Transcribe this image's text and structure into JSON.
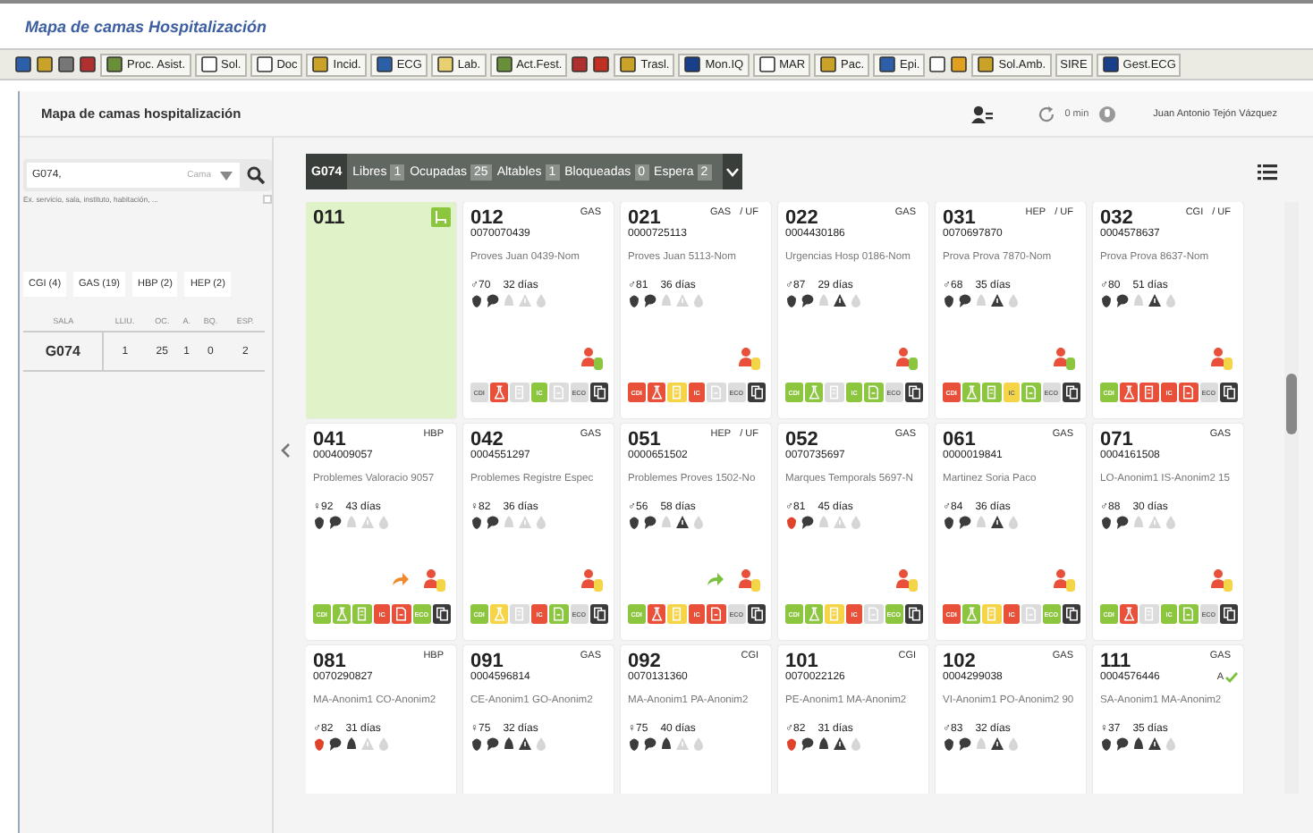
{
  "window": {
    "title": "Mapa de camas Hospitalización"
  },
  "toolbar": [
    {
      "kind": "icon",
      "color": "#2b5fa8"
    },
    {
      "kind": "icon",
      "color": "#c9a227"
    },
    {
      "kind": "icon",
      "color": "#777777"
    },
    {
      "kind": "icon",
      "color": "#b03030"
    },
    {
      "kind": "labeled",
      "color": "#6a8f3a",
      "label": "Proc. Asist."
    },
    {
      "kind": "labeled",
      "color": "#ffffff",
      "label": "Sol."
    },
    {
      "kind": "labeled",
      "color": "#ffffff",
      "label": "Doc"
    },
    {
      "kind": "labeled",
      "color": "#c9a227",
      "label": "Incid."
    },
    {
      "kind": "labeled",
      "color": "#2b5fa8",
      "label": "ECG"
    },
    {
      "kind": "labeled",
      "color": "#e8d070",
      "label": "Lab."
    },
    {
      "kind": "labeled",
      "color": "#6a8f3a",
      "label": "Act.Fest."
    },
    {
      "kind": "icon",
      "color": "#b03030"
    },
    {
      "kind": "icon",
      "color": "#c03020"
    },
    {
      "kind": "labeled",
      "color": "#c9a227",
      "label": "Trasl."
    },
    {
      "kind": "labeled",
      "color": "#1a3f8a",
      "label": "Mon.IQ"
    },
    {
      "kind": "labeled",
      "color": "#ffffff",
      "label": "MAR"
    },
    {
      "kind": "labeled",
      "color": "#c9a227",
      "label": "Pac."
    },
    {
      "kind": "labeled",
      "color": "#2b5fa8",
      "label": "Epi."
    },
    {
      "kind": "icon",
      "color": "#ffffff"
    },
    {
      "kind": "icon",
      "color": "#e0a020"
    },
    {
      "kind": "labeled",
      "color": "#c9a227",
      "label": "Sol.Amb."
    },
    {
      "kind": "text",
      "label": "SIRE"
    },
    {
      "kind": "labeled",
      "color": "#1a3f8a",
      "label": "Gest.ECG"
    }
  ],
  "header": {
    "title": "Mapa de camas hospitalización",
    "refresh": "0 min",
    "user": "Juan Antonio Tejón Vázquez"
  },
  "search": {
    "value": "G074,",
    "select_placeholder": "Cama",
    "hint": "Ex. servicio, sala, instituto, habitación, ...",
    "option_checked": false
  },
  "filters": [
    "CGI (4)",
    "GAS (19)",
    "HBP (2)",
    "HEP (2)"
  ],
  "ward_table": {
    "columns": [
      "SALA",
      "LLIU.",
      "OC.",
      "A.",
      "BQ.",
      "ESP."
    ],
    "rows": [
      [
        "G074",
        "1",
        "25",
        "1",
        "0",
        "2"
      ]
    ]
  },
  "summary": {
    "ward": "G074",
    "counts": [
      {
        "label": "Libres",
        "value": "1"
      },
      {
        "label": "Ocupadas",
        "value": "25"
      },
      {
        "label": "Altables",
        "value": "1"
      },
      {
        "label": "Bloqueadas",
        "value": "0"
      },
      {
        "label": "Espera",
        "value": "2"
      }
    ]
  },
  "beds": [
    {
      "kind": "free",
      "number": "011"
    },
    {
      "kind": "occupied",
      "number": "012",
      "service": "GAS",
      "nhc": "0070070439",
      "name": "Proves Juan 0439-Nom",
      "patient": "♂70",
      "stay": "32 días",
      "indicators": [
        {
          "kind": "pepper",
          "color": "#3c3c3c"
        },
        {
          "kind": "bubble",
          "color": "#3c3c3c"
        },
        {
          "kind": "bell",
          "color": "#d6d6d6"
        },
        {
          "kind": "warning",
          "color": "#d6d6d6"
        },
        {
          "kind": "drop",
          "color": "#d6d6d6"
        }
      ],
      "doctor": {
        "color": "#8cc63f"
      },
      "tags": [
        {
          "kind": "text",
          "label": "CDI",
          "color": "#dcdcdc"
        },
        {
          "kind": "flask",
          "color": "#e8503a"
        },
        {
          "kind": "doc",
          "color": "#dcdcdc"
        },
        {
          "kind": "text",
          "label": "IC",
          "color": "#8cc63f"
        },
        {
          "kind": "file",
          "color": "#dcdcdc"
        },
        {
          "kind": "text",
          "label": "ECO",
          "color": "#dcdcdc"
        },
        {
          "kind": "copy",
          "color": "#3a3a3a"
        }
      ]
    },
    {
      "kind": "occupied",
      "number": "021",
      "service": "GAS",
      "unit": "/ UF",
      "nhc": "0000725113",
      "name": "Proves Juan 5113-Nom",
      "patient": "♂81",
      "stay": "36 días",
      "indicators": [
        {
          "kind": "pepper",
          "color": "#3c3c3c"
        },
        {
          "kind": "bubble",
          "color": "#3c3c3c"
        },
        {
          "kind": "bell",
          "color": "#d6d6d6"
        },
        {
          "kind": "warning",
          "color": "#d6d6d6"
        },
        {
          "kind": "drop",
          "color": "#d6d6d6"
        }
      ],
      "doctor": {
        "color": "#f5d547"
      },
      "tags": [
        {
          "kind": "text",
          "label": "CDI",
          "color": "#e8503a"
        },
        {
          "kind": "flask",
          "color": "#e8503a"
        },
        {
          "kind": "doc",
          "color": "#f5d547"
        },
        {
          "kind": "text",
          "label": "IC",
          "color": "#e8503a"
        },
        {
          "kind": "file",
          "color": "#dcdcdc"
        },
        {
          "kind": "text",
          "label": "ECO",
          "color": "#dcdcdc"
        },
        {
          "kind": "copy",
          "color": "#3a3a3a"
        }
      ]
    },
    {
      "kind": "occupied",
      "number": "022",
      "service": "GAS",
      "nhc": "0004430186",
      "name": "Urgencias Hosp 0186-Nom",
      "patient": "♂87",
      "stay": "29 días",
      "indicators": [
        {
          "kind": "pepper",
          "color": "#3c3c3c"
        },
        {
          "kind": "bubble",
          "color": "#3c3c3c"
        },
        {
          "kind": "bell",
          "color": "#d6d6d6"
        },
        {
          "kind": "warning",
          "color": "#3c3c3c"
        },
        {
          "kind": "drop",
          "color": "#d6d6d6"
        }
      ],
      "doctor": {
        "color": "#8cc63f"
      },
      "tags": [
        {
          "kind": "text",
          "label": "CDI",
          "color": "#8cc63f"
        },
        {
          "kind": "flask",
          "color": "#8cc63f"
        },
        {
          "kind": "doc",
          "color": "#dcdcdc"
        },
        {
          "kind": "text",
          "label": "IC",
          "color": "#8cc63f"
        },
        {
          "kind": "file",
          "color": "#8cc63f"
        },
        {
          "kind": "text",
          "label": "ECO",
          "color": "#dcdcdc"
        },
        {
          "kind": "copy",
          "color": "#3a3a3a"
        }
      ]
    },
    {
      "kind": "occupied",
      "number": "031",
      "service": "HEP",
      "unit": "/ UF",
      "nhc": "0070697870",
      "name": "Prova Prova 7870-Nom",
      "patient": "♂68",
      "stay": "35 días",
      "indicators": [
        {
          "kind": "pepper",
          "color": "#3c3c3c"
        },
        {
          "kind": "bubble",
          "color": "#3c3c3c"
        },
        {
          "kind": "bell",
          "color": "#d6d6d6"
        },
        {
          "kind": "warning",
          "color": "#3c3c3c"
        },
        {
          "kind": "drop",
          "color": "#d6d6d6"
        }
      ],
      "doctor": {
        "color": "#8cc63f"
      },
      "tags": [
        {
          "kind": "text",
          "label": "CDI",
          "color": "#e8503a"
        },
        {
          "kind": "flask",
          "color": "#8cc63f"
        },
        {
          "kind": "doc",
          "color": "#8cc63f"
        },
        {
          "kind": "text",
          "label": "IC",
          "color": "#f5d547"
        },
        {
          "kind": "file",
          "color": "#8cc63f"
        },
        {
          "kind": "text",
          "label": "ECO",
          "color": "#dcdcdc"
        },
        {
          "kind": "copy",
          "color": "#3a3a3a"
        }
      ]
    },
    {
      "kind": "occupied",
      "number": "032",
      "service": "CGI",
      "unit": "/ UF",
      "nhc": "0004578637",
      "name": "Prova Prova 8637-Nom",
      "patient": "♂80",
      "stay": "51 días",
      "indicators": [
        {
          "kind": "pepper",
          "color": "#3c3c3c"
        },
        {
          "kind": "bubble",
          "color": "#3c3c3c"
        },
        {
          "kind": "bell",
          "color": "#d6d6d6"
        },
        {
          "kind": "warning",
          "color": "#3c3c3c"
        },
        {
          "kind": "drop",
          "color": "#d6d6d6"
        }
      ],
      "doctor": {
        "color": "#f5d547"
      },
      "tags": [
        {
          "kind": "text",
          "label": "CDI",
          "color": "#8cc63f"
        },
        {
          "kind": "flask",
          "color": "#e8503a"
        },
        {
          "kind": "doc",
          "color": "#e8503a"
        },
        {
          "kind": "text",
          "label": "IC",
          "color": "#e8503a"
        },
        {
          "kind": "file",
          "color": "#e8503a"
        },
        {
          "kind": "text",
          "label": "ECO",
          "color": "#dcdcdc"
        },
        {
          "kind": "copy",
          "color": "#3a3a3a"
        }
      ]
    },
    {
      "kind": "occupied",
      "number": "041",
      "service": "HBP",
      "nhc": "0004009057",
      "name": "Problemes Valoracio 9057",
      "patient": "♀92",
      "stay": "43 días",
      "indicators": [
        {
          "kind": "pepper",
          "color": "#3c3c3c"
        },
        {
          "kind": "bubble",
          "color": "#3c3c3c"
        },
        {
          "kind": "bell",
          "color": "#d6d6d6"
        },
        {
          "kind": "warning",
          "color": "#d6d6d6"
        },
        {
          "kind": "drop",
          "color": "#d6d6d6"
        }
      ],
      "arrow": {
        "color": "#f08a30"
      },
      "doctor": {
        "color": "#f5d547"
      },
      "tags": [
        {
          "kind": "text",
          "label": "CDI",
          "color": "#8cc63f"
        },
        {
          "kind": "flask",
          "color": "#8cc63f"
        },
        {
          "kind": "doc",
          "color": "#8cc63f"
        },
        {
          "kind": "text",
          "label": "IC",
          "color": "#e8503a"
        },
        {
          "kind": "file",
          "color": "#e8503a"
        },
        {
          "kind": "text",
          "label": "ECO",
          "color": "#8cc63f"
        },
        {
          "kind": "copy",
          "color": "#3a3a3a"
        }
      ]
    },
    {
      "kind": "occupied",
      "number": "042",
      "service": "GAS",
      "nhc": "0004551297",
      "name": "Problemes Registre Espec",
      "patient": "♀82",
      "stay": "36 días",
      "indicators": [
        {
          "kind": "pepper",
          "color": "#3c3c3c"
        },
        {
          "kind": "bubble",
          "color": "#3c3c3c"
        },
        {
          "kind": "bell",
          "color": "#d6d6d6"
        },
        {
          "kind": "warning",
          "color": "#d6d6d6"
        },
        {
          "kind": "drop",
          "color": "#d6d6d6"
        }
      ],
      "doctor": {
        "color": "#f5d547"
      },
      "tags": [
        {
          "kind": "text",
          "label": "CDI",
          "color": "#8cc63f"
        },
        {
          "kind": "flask",
          "color": "#f5d547"
        },
        {
          "kind": "doc",
          "color": "#dcdcdc"
        },
        {
          "kind": "text",
          "label": "IC",
          "color": "#e8503a"
        },
        {
          "kind": "file",
          "color": "#8cc63f"
        },
        {
          "kind": "text",
          "label": "ECO",
          "color": "#dcdcdc"
        },
        {
          "kind": "copy",
          "color": "#3a3a3a"
        }
      ]
    },
    {
      "kind": "occupied",
      "number": "051",
      "service": "HEP",
      "unit": "/ UF",
      "nhc": "0000651502",
      "name": "Problemes Proves 1502-No",
      "patient": "♂56",
      "stay": "58 días",
      "indicators": [
        {
          "kind": "pepper",
          "color": "#3c3c3c"
        },
        {
          "kind": "bubble",
          "color": "#3c3c3c"
        },
        {
          "kind": "bell",
          "color": "#d6d6d6"
        },
        {
          "kind": "warning",
          "color": "#3c3c3c"
        },
        {
          "kind": "drop",
          "color": "#d6d6d6"
        }
      ],
      "arrow": {
        "color": "#7cc040"
      },
      "doctor": {
        "color": "#f5d547"
      },
      "tags": [
        {
          "kind": "text",
          "label": "CDI",
          "color": "#8cc63f"
        },
        {
          "kind": "flask",
          "color": "#e8503a"
        },
        {
          "kind": "doc",
          "color": "#f5d547"
        },
        {
          "kind": "text",
          "label": "IC",
          "color": "#e8503a"
        },
        {
          "kind": "file",
          "color": "#e8503a"
        },
        {
          "kind": "text",
          "label": "ECO",
          "color": "#dcdcdc"
        },
        {
          "kind": "copy",
          "color": "#3a3a3a"
        }
      ]
    },
    {
      "kind": "occupied",
      "number": "052",
      "service": "GAS",
      "nhc": "0070735697",
      "name": "Marques Temporals 5697-N",
      "patient": "♂81",
      "stay": "45 días",
      "indicators": [
        {
          "kind": "pepper",
          "color": "#e0432b"
        },
        {
          "kind": "bubble",
          "color": "#3c3c3c"
        },
        {
          "kind": "bell",
          "color": "#d6d6d6"
        },
        {
          "kind": "warning",
          "color": "#d6d6d6"
        },
        {
          "kind": "drop",
          "color": "#d6d6d6"
        }
      ],
      "doctor": {
        "color": "#f5d547"
      },
      "tags": [
        {
          "kind": "text",
          "label": "CDI",
          "color": "#8cc63f"
        },
        {
          "kind": "flask",
          "color": "#8cc63f"
        },
        {
          "kind": "doc",
          "color": "#f5d547"
        },
        {
          "kind": "text",
          "label": "IC",
          "color": "#e8503a"
        },
        {
          "kind": "file",
          "color": "#dcdcdc"
        },
        {
          "kind": "text",
          "label": "ECO",
          "color": "#8cc63f"
        },
        {
          "kind": "copy",
          "color": "#3a3a3a"
        }
      ]
    },
    {
      "kind": "occupied",
      "number": "061",
      "service": "GAS",
      "nhc": "0000019841",
      "name": "Martinez Soria Paco",
      "patient": "♂84",
      "stay": "36 días",
      "indicators": [
        {
          "kind": "pepper",
          "color": "#3c3c3c"
        },
        {
          "kind": "bubble",
          "color": "#3c3c3c"
        },
        {
          "kind": "bell",
          "color": "#d6d6d6"
        },
        {
          "kind": "warning",
          "color": "#3c3c3c"
        },
        {
          "kind": "drop",
          "color": "#d6d6d6"
        }
      ],
      "doctor": {
        "color": "#f5d547"
      },
      "tags": [
        {
          "kind": "text",
          "label": "CDI",
          "color": "#e8503a"
        },
        {
          "kind": "flask",
          "color": "#8cc63f"
        },
        {
          "kind": "doc",
          "color": "#f5d547"
        },
        {
          "kind": "text",
          "label": "IC",
          "color": "#e8503a"
        },
        {
          "kind": "file",
          "color": "#dcdcdc"
        },
        {
          "kind": "text",
          "label": "ECO",
          "color": "#8cc63f"
        },
        {
          "kind": "copy",
          "color": "#3a3a3a"
        }
      ]
    },
    {
      "kind": "occupied",
      "number": "071",
      "service": "GAS",
      "nhc": "0004161508",
      "name": "LO-Anonim1 IS-Anonim2 15",
      "patient": "♂88",
      "stay": "30 días",
      "indicators": [
        {
          "kind": "pepper",
          "color": "#3c3c3c"
        },
        {
          "kind": "bubble",
          "color": "#3c3c3c"
        },
        {
          "kind": "bell",
          "color": "#d6d6d6"
        },
        {
          "kind": "warning",
          "color": "#d6d6d6"
        },
        {
          "kind": "drop",
          "color": "#d6d6d6"
        }
      ],
      "doctor": {
        "color": "#f5d547"
      },
      "tags": [
        {
          "kind": "text",
          "label": "CDI",
          "color": "#8cc63f"
        },
        {
          "kind": "flask",
          "color": "#e8503a"
        },
        {
          "kind": "doc",
          "color": "#dcdcdc"
        },
        {
          "kind": "text",
          "label": "IC",
          "color": "#8cc63f"
        },
        {
          "kind": "file",
          "color": "#8cc63f"
        },
        {
          "kind": "text",
          "label": "ECO",
          "color": "#dcdcdc"
        },
        {
          "kind": "copy",
          "color": "#3a3a3a"
        }
      ]
    },
    {
      "kind": "occupied",
      "number": "081",
      "service": "HBP",
      "nhc": "0070290827",
      "name": "MA-Anonim1 CO-Anonim2",
      "patient": "♂82",
      "stay": "31 días",
      "indicators": [
        {
          "kind": "pepper",
          "color": "#e0432b"
        },
        {
          "kind": "bubble",
          "color": "#3c3c3c"
        },
        {
          "kind": "bell",
          "color": "#3c3c3c"
        },
        {
          "kind": "warning",
          "color": "#d6d6d6"
        },
        {
          "kind": "drop",
          "color": "#d6d6d6"
        }
      ]
    },
    {
      "kind": "occupied",
      "number": "091",
      "service": "GAS",
      "nhc": "0004596814",
      "name": "CE-Anonim1 GO-Anonim2",
      "patient": "♀75",
      "stay": "32 días",
      "indicators": [
        {
          "kind": "pepper",
          "color": "#3c3c3c"
        },
        {
          "kind": "bubble",
          "color": "#3c3c3c"
        },
        {
          "kind": "bell",
          "color": "#3c3c3c"
        },
        {
          "kind": "warning",
          "color": "#3c3c3c"
        },
        {
          "kind": "drop",
          "color": "#d6d6d6"
        }
      ]
    },
    {
      "kind": "occupied",
      "number": "092",
      "service": "CGI",
      "nhc": "0070131360",
      "name": "MA-Anonim1 PA-Anonim2",
      "patient": "♀75",
      "stay": "40 días",
      "indicators": [
        {
          "kind": "pepper",
          "color": "#3c3c3c"
        },
        {
          "kind": "bubble",
          "color": "#3c3c3c"
        },
        {
          "kind": "bell",
          "color": "#3c3c3c"
        },
        {
          "kind": "warning",
          "color": "#d6d6d6"
        },
        {
          "kind": "drop",
          "color": "#d6d6d6"
        }
      ]
    },
    {
      "kind": "occupied",
      "number": "101",
      "service": "CGI",
      "nhc": "0070022126",
      "name": "PE-Anonim1 MA-Anonim2",
      "patient": "♂82",
      "stay": "31 días",
      "indicators": [
        {
          "kind": "pepper",
          "color": "#e0432b"
        },
        {
          "kind": "bubble",
          "color": "#3c3c3c"
        },
        {
          "kind": "bell",
          "color": "#3c3c3c"
        },
        {
          "kind": "warning",
          "color": "#3c3c3c"
        },
        {
          "kind": "drop",
          "color": "#d6d6d6"
        }
      ]
    },
    {
      "kind": "occupied",
      "number": "102",
      "service": "GAS",
      "nhc": "0004299038",
      "name": "VI-Anonim1 PO-Anonim2 90",
      "patient": "♂83",
      "stay": "32 días",
      "indicators": [
        {
          "kind": "pepper",
          "color": "#3c3c3c"
        },
        {
          "kind": "bubble",
          "color": "#3c3c3c"
        },
        {
          "kind": "bell",
          "color": "#d6d6d6"
        },
        {
          "kind": "warning",
          "color": "#3c3c3c"
        },
        {
          "kind": "drop",
          "color": "#d6d6d6"
        }
      ]
    },
    {
      "kind": "occupied",
      "number": "111",
      "service": "GAS",
      "nhc": "0004576446",
      "name": "SA-Anonim1 MA-Anonim2",
      "patient": "♀37",
      "stay": "35 días",
      "mark": "A",
      "indicators": [
        {
          "kind": "pepper",
          "color": "#3c3c3c"
        },
        {
          "kind": "bubble",
          "color": "#3c3c3c"
        },
        {
          "kind": "bell",
          "color": "#3c3c3c"
        },
        {
          "kind": "warning",
          "color": "#3c3c3c"
        },
        {
          "kind": "drop",
          "color": "#d6d6d6"
        }
      ]
    }
  ]
}
